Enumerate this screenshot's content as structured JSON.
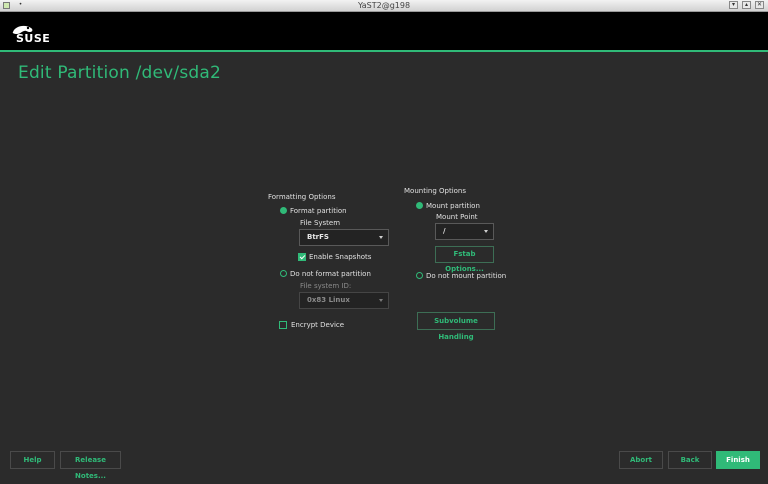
{
  "window": {
    "title": "YaST2@g198"
  },
  "header": {
    "logo_text": "SUSE"
  },
  "page": {
    "title": "Edit Partition /dev/sda2"
  },
  "formatting": {
    "heading": "Formatting Options",
    "format_label": "Format partition",
    "format_selected": true,
    "fs_label": "File System",
    "fs_value": "BtrFS",
    "snapshots_label": "Enable Snapshots",
    "snapshots_checked": true,
    "no_format_label": "Do not format partition",
    "fsid_label": "File system ID:",
    "fsid_value": "0x83 Linux",
    "encrypt_label": "Encrypt Device",
    "encrypt_checked": false
  },
  "mounting": {
    "heading": "Mounting Options",
    "mount_label": "Mount partition",
    "mount_selected": true,
    "mountpoint_label": "Mount Point",
    "mountpoint_value": "/",
    "fstab_button": "Fstab Options...",
    "no_mount_label": "Do not mount partition",
    "subvolume_button": "Subvolume Handling"
  },
  "footer": {
    "help": "Help",
    "release_notes": "Release Notes...",
    "abort": "Abort",
    "back": "Back",
    "finish": "Finish"
  },
  "colors": {
    "accent": "#30ba78",
    "background": "#2b2b2b",
    "header": "#000000"
  }
}
